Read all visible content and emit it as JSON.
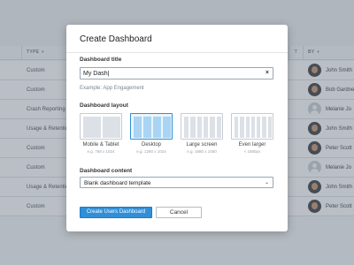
{
  "table": {
    "headers": {
      "type": "TYPE",
      "by": "BY"
    },
    "rows": [
      {
        "type": "Custom",
        "name": "John Smith",
        "avatar": "photo"
      },
      {
        "type": "Custom",
        "name": "Bob Gardner",
        "avatar": "photo"
      },
      {
        "type": "Crash Reporting",
        "name": "Melanie Jo",
        "avatar": "blank"
      },
      {
        "type": "Usage & Retention",
        "name": "John Smith",
        "avatar": "photo"
      },
      {
        "type": "Custom",
        "name": "Peter Scott",
        "avatar": "photo"
      },
      {
        "type": "Custom",
        "name": "Melanie Jo",
        "avatar": "blank"
      },
      {
        "type": "Usage & Retention",
        "name": "John Smith",
        "avatar": "photo"
      },
      {
        "type": "Custom",
        "name": "Peter Scott",
        "avatar": "photo"
      }
    ]
  },
  "modal": {
    "title": "Create Dashboard",
    "title_label": "Dashboard title",
    "title_value": "My Dash|",
    "title_hint": "Example: App Engagement",
    "layout_label": "Dashboard layout",
    "layouts": [
      {
        "name": "Mobile & Tablet",
        "dims": "e.g. 768 x 1024",
        "columns": 2,
        "selected": false
      },
      {
        "name": "Desktop",
        "dims": "e.g. 1280 x 1024",
        "columns": 4,
        "selected": true
      },
      {
        "name": "Large screen",
        "dims": "e.g. 1680 x 1050",
        "columns": 6,
        "selected": false
      },
      {
        "name": "Even larger",
        "dims": "< 1680px",
        "columns": 7,
        "selected": false
      }
    ],
    "content_label": "Dashboard content",
    "content_value": "Blank dashboard template",
    "primary_button": "Create Users Dashboard",
    "secondary_button": "Cancel"
  },
  "colors": {
    "accent": "#2f8fd8",
    "selected_layout_bg": "#eaf5fd"
  },
  "icons": {
    "clear": "close-icon",
    "select": "chevron-down-icon",
    "filter": "filter-icon"
  }
}
